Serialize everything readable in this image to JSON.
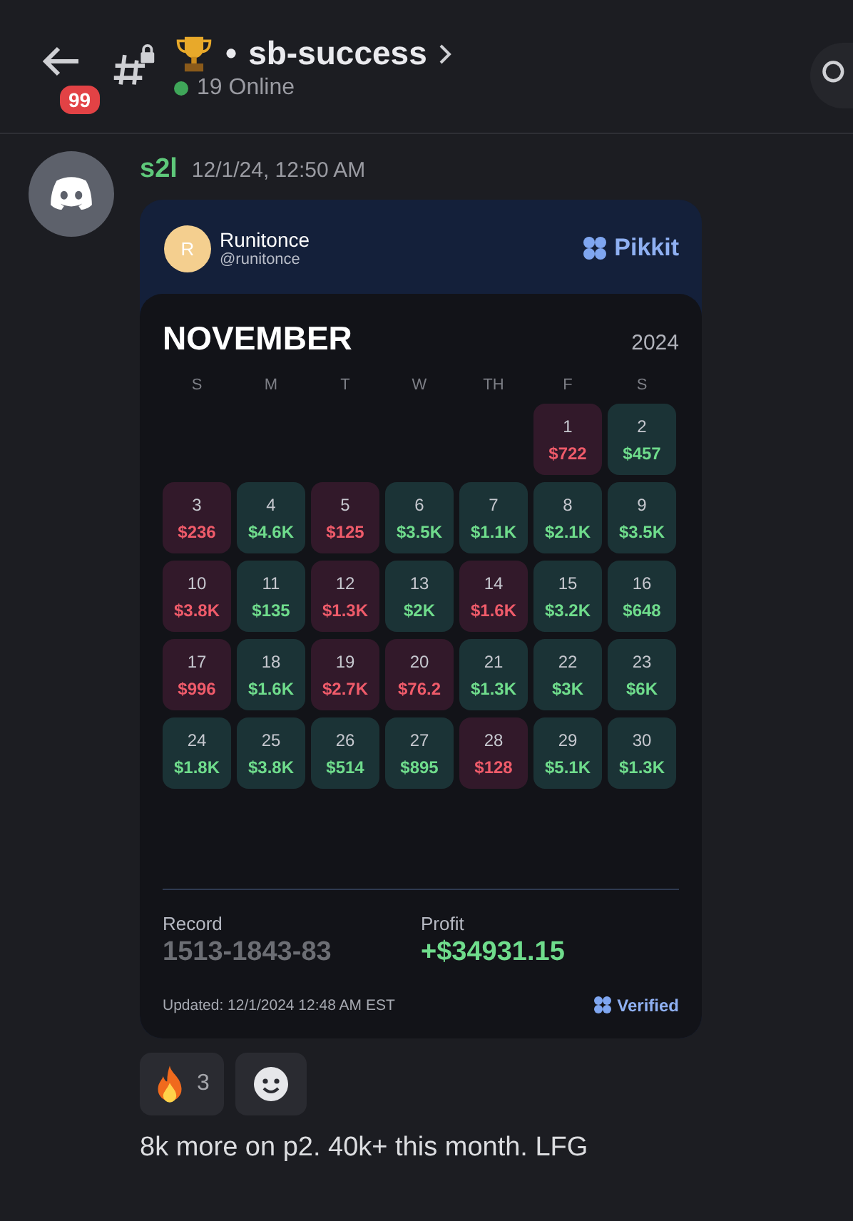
{
  "header": {
    "unread_badge": "99",
    "separator": "•",
    "channel": "sb-success",
    "online": "19 Online"
  },
  "message": {
    "author": "s2l",
    "timestamp": "12/1/24, 12:50 AM",
    "text": "8k more on p2. 40k+ this month. LFG",
    "embed": {
      "user": {
        "initial": "R",
        "name": "Runitonce",
        "handle": "@runitonce"
      },
      "brand": "Pikkit",
      "month": "NOVEMBER",
      "year": "2024",
      "weekdays": [
        "S",
        "M",
        "T",
        "W",
        "TH",
        "F",
        "S"
      ],
      "days": [
        {
          "kind": "empty"
        },
        {
          "kind": "empty"
        },
        {
          "kind": "empty"
        },
        {
          "kind": "empty"
        },
        {
          "kind": "empty"
        },
        {
          "kind": "loss",
          "day": "1",
          "amount": "$722"
        },
        {
          "kind": "win",
          "day": "2",
          "amount": "$457"
        },
        {
          "kind": "loss",
          "day": "3",
          "amount": "$236"
        },
        {
          "kind": "win",
          "day": "4",
          "amount": "$4.6K"
        },
        {
          "kind": "loss",
          "day": "5",
          "amount": "$125"
        },
        {
          "kind": "win",
          "day": "6",
          "amount": "$3.5K"
        },
        {
          "kind": "win",
          "day": "7",
          "amount": "$1.1K"
        },
        {
          "kind": "win",
          "day": "8",
          "amount": "$2.1K"
        },
        {
          "kind": "win",
          "day": "9",
          "amount": "$3.5K"
        },
        {
          "kind": "loss",
          "day": "10",
          "amount": "$3.8K"
        },
        {
          "kind": "win",
          "day": "11",
          "amount": "$135"
        },
        {
          "kind": "loss",
          "day": "12",
          "amount": "$1.3K"
        },
        {
          "kind": "win",
          "day": "13",
          "amount": "$2K"
        },
        {
          "kind": "loss",
          "day": "14",
          "amount": "$1.6K"
        },
        {
          "kind": "win",
          "day": "15",
          "amount": "$3.2K"
        },
        {
          "kind": "win",
          "day": "16",
          "amount": "$648"
        },
        {
          "kind": "loss",
          "day": "17",
          "amount": "$996"
        },
        {
          "kind": "win",
          "day": "18",
          "amount": "$1.6K"
        },
        {
          "kind": "loss",
          "day": "19",
          "amount": "$2.7K"
        },
        {
          "kind": "loss",
          "day": "20",
          "amount": "$76.2"
        },
        {
          "kind": "win",
          "day": "21",
          "amount": "$1.3K"
        },
        {
          "kind": "win",
          "day": "22",
          "amount": "$3K"
        },
        {
          "kind": "win",
          "day": "23",
          "amount": "$6K"
        },
        {
          "kind": "win",
          "day": "24",
          "amount": "$1.8K"
        },
        {
          "kind": "win",
          "day": "25",
          "amount": "$3.8K"
        },
        {
          "kind": "win",
          "day": "26",
          "amount": "$514"
        },
        {
          "kind": "win",
          "day": "27",
          "amount": "$895"
        },
        {
          "kind": "loss",
          "day": "28",
          "amount": "$128"
        },
        {
          "kind": "win",
          "day": "29",
          "amount": "$5.1K"
        },
        {
          "kind": "win",
          "day": "30",
          "amount": "$1.3K"
        }
      ],
      "record_label": "Record",
      "record": "1513-1843-83",
      "profit_label": "Profit",
      "profit": "+$34931.15",
      "updated": "Updated: 12/1/2024 12:48 AM EST",
      "verified": "Verified"
    },
    "reactions": [
      {
        "kind": "fire",
        "count": "3"
      },
      {
        "kind": "add"
      }
    ]
  }
}
